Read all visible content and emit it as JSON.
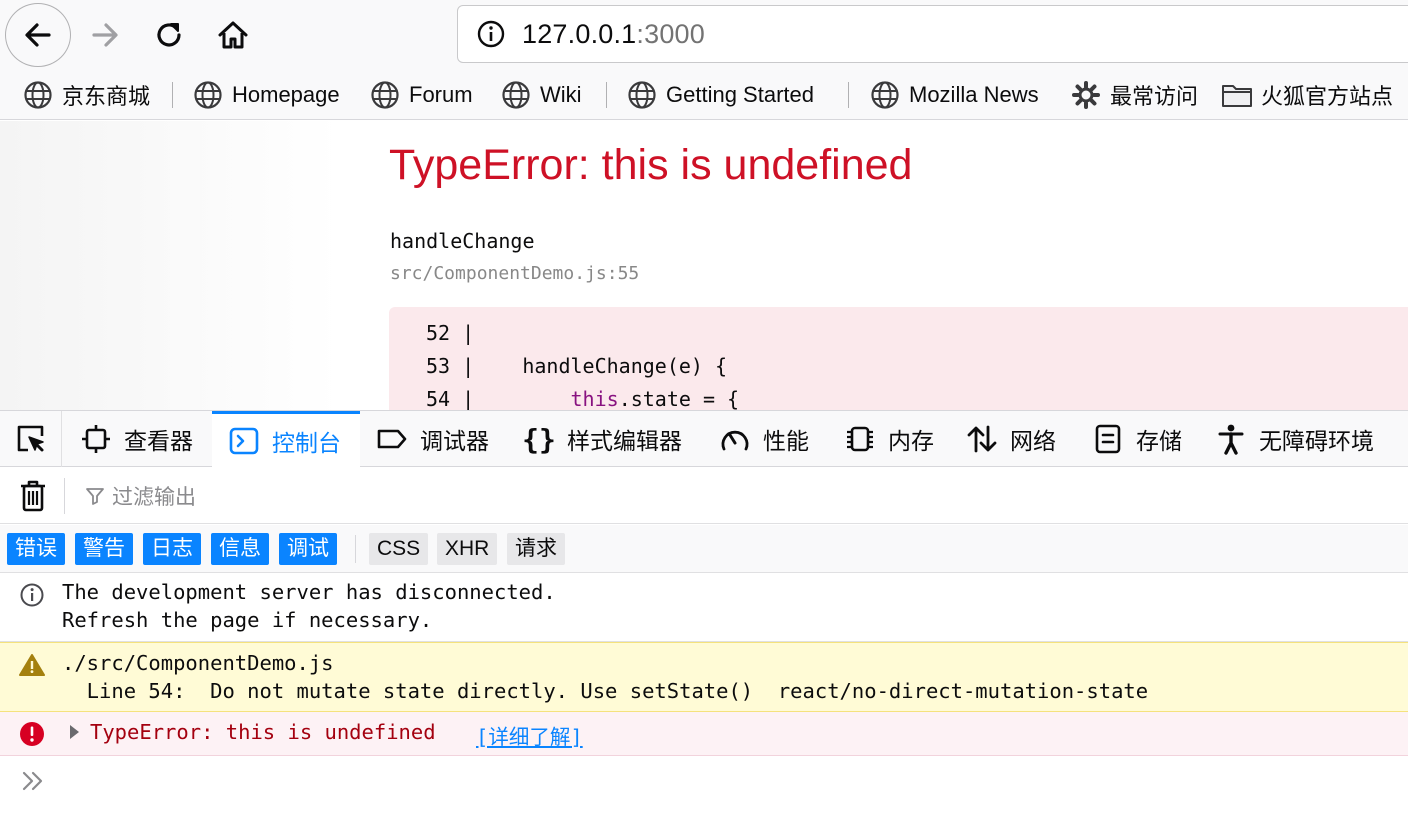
{
  "toolbar": {
    "url_host": "127.0.0.1",
    "url_port": ":3000"
  },
  "bookmarks": [
    {
      "label": "京东商城",
      "icon": "globe-icon"
    },
    {
      "label": "Homepage",
      "icon": "globe-icon"
    },
    {
      "label": "Forum",
      "icon": "globe-icon"
    },
    {
      "label": "Wiki",
      "icon": "globe-icon"
    },
    {
      "label": "Getting Started",
      "icon": "globe-icon"
    },
    {
      "label": "Mozilla News",
      "icon": "globe-icon"
    },
    {
      "label": "最常访问",
      "icon": "gear-icon"
    },
    {
      "label": "火狐官方站点",
      "icon": "folder-icon"
    }
  ],
  "page": {
    "error_title": "TypeError: this is undefined",
    "function_name": "handleChange",
    "file_location": "src/ComponentDemo.js:55",
    "code_lines": [
      {
        "num": "52",
        "sep": " |",
        "code": ""
      },
      {
        "num": "53",
        "sep": " |",
        "code": "    handleChange(e) {"
      },
      {
        "num": "54",
        "sep": " |",
        "code_kw": "this",
        "code": ".state = {"
      }
    ]
  },
  "devtools": {
    "tabs": [
      {
        "label": "查看器",
        "icon": "inspector-icon"
      },
      {
        "label": "控制台",
        "icon": "console-icon",
        "active": true
      },
      {
        "label": "调试器",
        "icon": "debugger-icon"
      },
      {
        "label": "样式编辑器",
        "icon": "style-editor-icon"
      },
      {
        "label": "性能",
        "icon": "performance-icon"
      },
      {
        "label": "内存",
        "icon": "memory-icon"
      },
      {
        "label": "网络",
        "icon": "network-icon"
      },
      {
        "label": "存储",
        "icon": "storage-icon"
      },
      {
        "label": "无障碍环境",
        "icon": "accessibility-icon"
      }
    ],
    "filter_placeholder": "过滤输出",
    "categories_on": [
      "错误",
      "警告",
      "日志",
      "信息",
      "调试"
    ],
    "categories_off": [
      "CSS",
      "XHR",
      "请求"
    ],
    "messages": {
      "info_line1": "The development server has disconnected.",
      "info_line2": "Refresh the page if necessary.",
      "warn_line1": "./src/ComponentDemo.js",
      "warn_line2": "  Line 54:  Do not mutate state directly. Use setState()  react/no-direct-mutation-state",
      "error_text": "TypeError: this is undefined",
      "learn_more": "[详细了解]"
    }
  },
  "colors": {
    "accent": "#0a84ff",
    "error_red": "#ce1126",
    "warning_bg": "#fffbd6",
    "error_bg": "#fdf2f5"
  }
}
